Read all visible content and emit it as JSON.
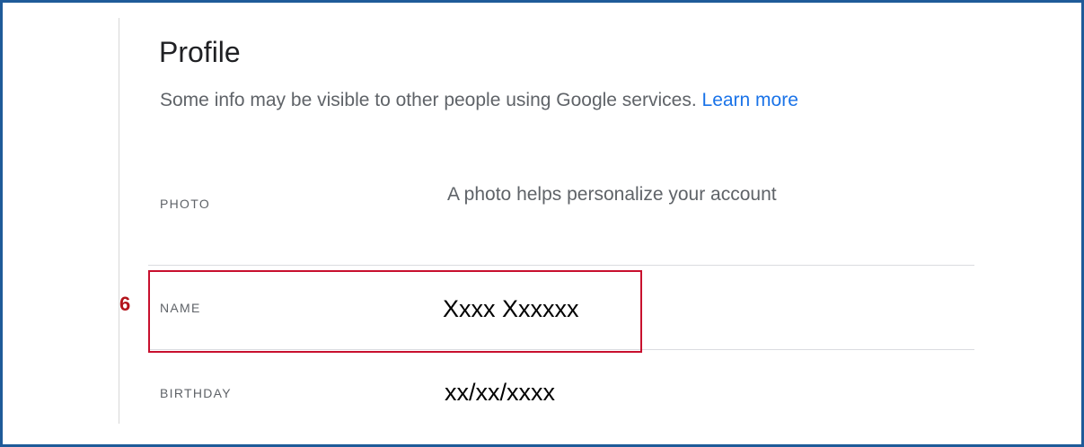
{
  "profile": {
    "title": "Profile",
    "subtitle": "Some info may be visible to other people using Google services.",
    "learn_more": "Learn more"
  },
  "rows": {
    "photo": {
      "label": "PHOTO",
      "value": "A photo helps personalize your account"
    },
    "name": {
      "label": "NAME",
      "value": "Xxxx Xxxxxx"
    },
    "birthday": {
      "label": "BIRTHDAY",
      "value": "xx/xx/xxxx"
    }
  },
  "annotation": {
    "step_number": "6",
    "highlight_color": "#c8102e"
  },
  "colors": {
    "frame": "#1f5b99",
    "link": "#1a73e8",
    "muted_text": "#5f6368"
  }
}
